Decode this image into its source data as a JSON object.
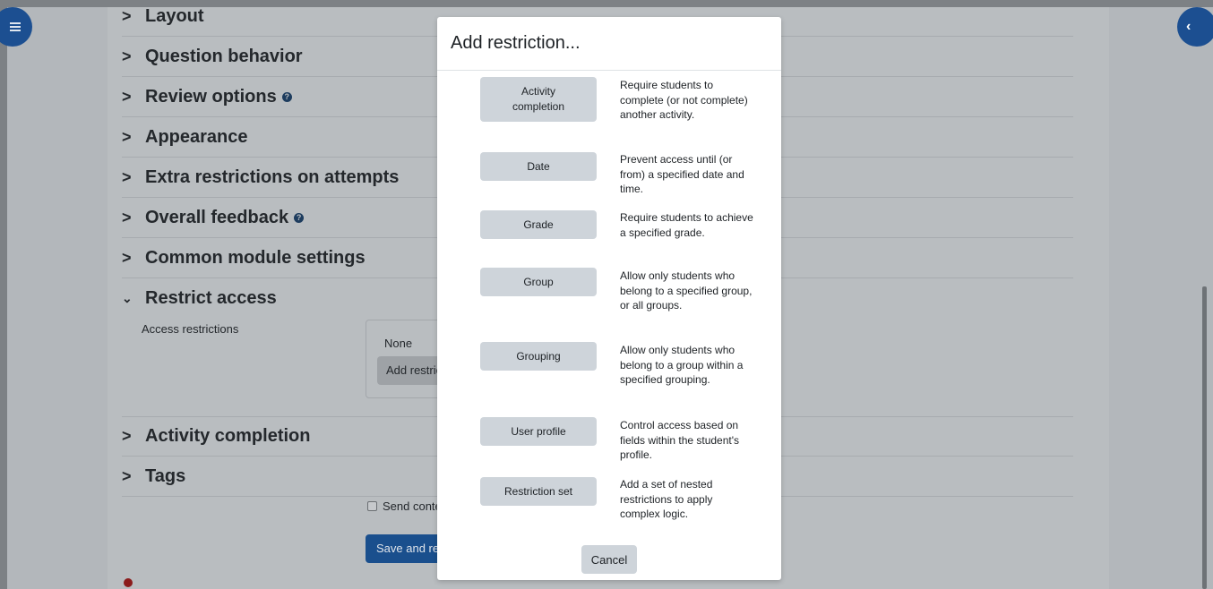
{
  "sections": [
    {
      "label": "Layout",
      "expanded": false,
      "help": false
    },
    {
      "label": "Question behavior",
      "expanded": false,
      "help": false
    },
    {
      "label": "Review options",
      "expanded": false,
      "help": true
    },
    {
      "label": "Appearance",
      "expanded": false,
      "help": false
    },
    {
      "label": "Extra restrictions on attempts",
      "expanded": false,
      "help": false
    },
    {
      "label": "Overall feedback",
      "expanded": false,
      "help": true
    },
    {
      "label": "Common module settings",
      "expanded": false,
      "help": false
    },
    {
      "label": "Restrict access",
      "expanded": true,
      "help": false
    },
    {
      "label": "Activity completion",
      "expanded": false,
      "help": false
    },
    {
      "label": "Tags",
      "expanded": false,
      "help": false
    }
  ],
  "restrict": {
    "label": "Access restrictions",
    "none_text": "None",
    "add_button": "Add restriction..."
  },
  "footer": {
    "send_label": "Send content change notification",
    "save_button": "Save and return to course"
  },
  "modal": {
    "title": "Add restriction...",
    "options": [
      {
        "button": "Activity completion",
        "description": "Require students to complete (or not complete) another activity."
      },
      {
        "button": "Date",
        "description": "Prevent access until (or from) a specified date and time."
      },
      {
        "button": "Grade",
        "description": "Require students to achieve a specified grade."
      },
      {
        "button": "Group",
        "description": "Allow only students who belong to a specified group, or all groups."
      },
      {
        "button": "Grouping",
        "description": "Allow only students who belong to a group within a specified grouping."
      },
      {
        "button": "User profile",
        "description": "Control access based on fields within the student's profile."
      },
      {
        "button": "Restriction set",
        "description": "Add a set of nested restrictions to apply complex logic."
      }
    ],
    "cancel": "Cancel"
  },
  "colors": {
    "primary": "#1c4f91",
    "overlay": "#b9bdc0",
    "option_button": "#ced4da"
  },
  "icons": {
    "left_drawer": "menu-icon",
    "right_drawer": "chevron-left-icon",
    "section_collapsed": "chevron-right-icon",
    "section_expanded": "chevron-down-icon",
    "help": "question-circle-icon"
  }
}
